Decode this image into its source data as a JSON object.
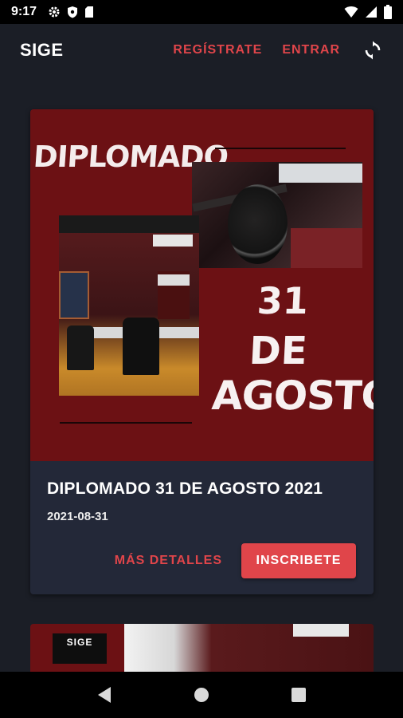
{
  "status_bar": {
    "time": "9:17",
    "icons_left": [
      "gear-icon",
      "shield-icon",
      "sd-card-icon"
    ],
    "icons_right": [
      "wifi-icon",
      "signal-icon",
      "battery-icon"
    ]
  },
  "app_bar": {
    "title": "SIGE",
    "register_label": "REGÍSTRATE",
    "login_label": "ENTRAR",
    "refresh_icon": "refresh-icon"
  },
  "card": {
    "poster": {
      "headline": "DIPLOMADO",
      "day": "31",
      "de": "DE",
      "month": "AGOSTO"
    },
    "title": "DIPLOMADO 31 DE AGOSTO 2021",
    "date": "2021-08-31",
    "details_label": "MÁS DETALLES",
    "enroll_label": "INSCRIBETE"
  },
  "card_2": {
    "logo_text": "SIGE"
  },
  "colors": {
    "background": "#1b1e26",
    "card": "#232838",
    "accent": "#e0454a",
    "poster": "#6c1114"
  },
  "nav_bar": {
    "icons": [
      "back-icon",
      "home-icon",
      "recents-icon"
    ]
  }
}
